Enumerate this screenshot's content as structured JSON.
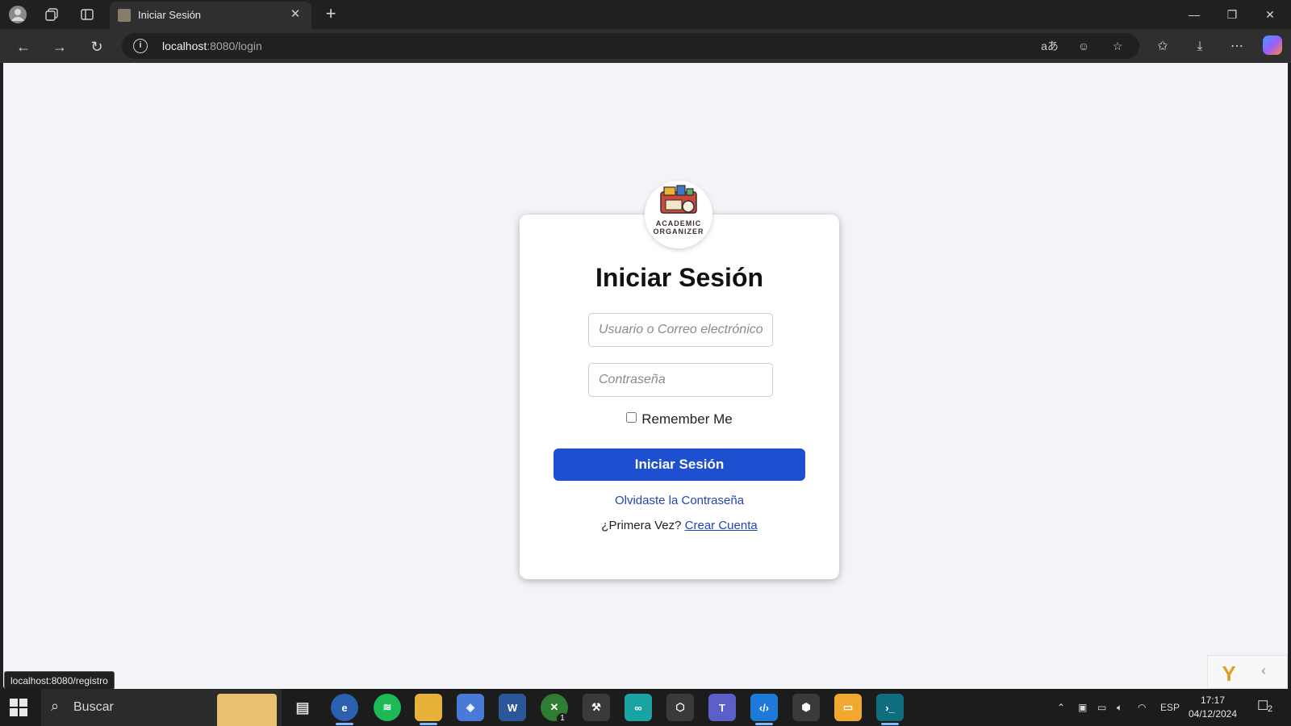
{
  "browser": {
    "tab_title": "Iniciar Sesión",
    "url_host": "localhost",
    "url_rest": ":8080/login",
    "status_link": "localhost:8080/registro"
  },
  "login": {
    "logo_line1": "ACADEMIC",
    "logo_line2": "ORGANIZER",
    "title": "Iniciar Sesión",
    "username_placeholder": "Usuario o Correo electrónico",
    "password_placeholder": "Contraseña",
    "remember_label": "Remember Me",
    "submit_label": "Iniciar Sesión",
    "forgot_link": "Olvidaste la Contraseña",
    "first_time_text": "¿Primera Vez?",
    "create_account_link": "Crear Cuenta"
  },
  "taskbar": {
    "search_label": "Buscar",
    "language": "ESP",
    "time": "17:17",
    "date": "04/12/2024",
    "notification_count": "2",
    "xbox_badge": "1",
    "word_label": "W",
    "teams_label": "T"
  },
  "colors": {
    "primary_button": "#1f4fd1",
    "link": "#1e47b8",
    "page_background": "#f4f4f8"
  }
}
